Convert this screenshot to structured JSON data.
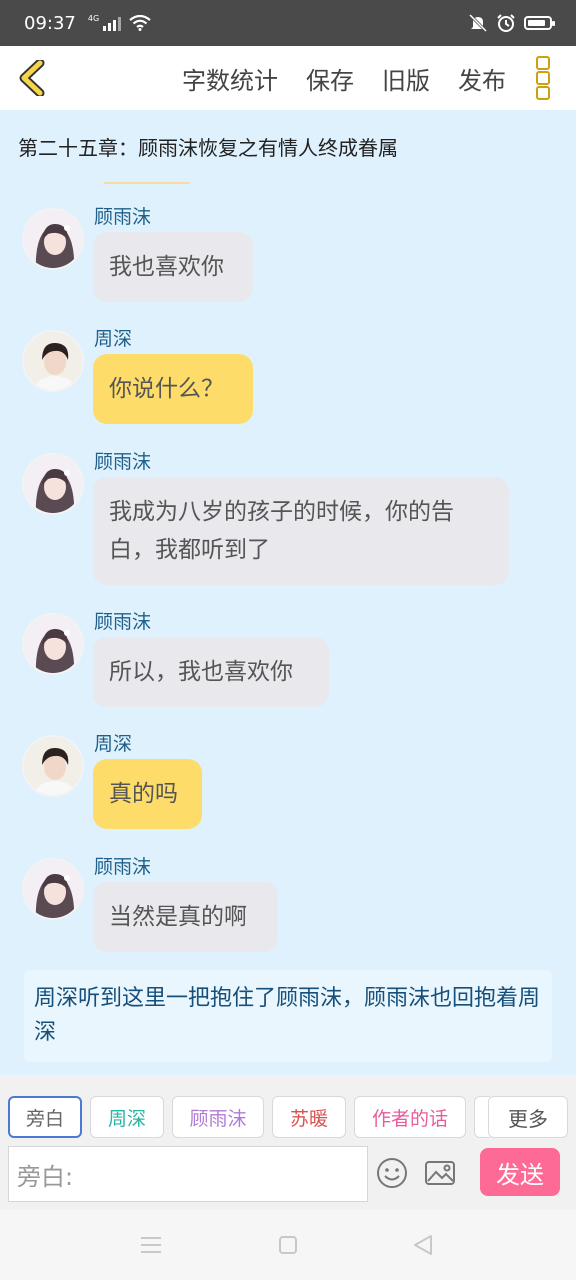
{
  "status_bar": {
    "time": "09:37",
    "network": "4G"
  },
  "toolbar": {
    "items": [
      "字数统计",
      "保存",
      "旧版",
      "发布"
    ]
  },
  "chapter_title": "第二十五章：顾雨沫恢复之有情人终成眷属",
  "messages": [
    {
      "speaker": "顾雨沫",
      "text": "我也喜欢你",
      "side": "female"
    },
    {
      "speaker": "周深",
      "text": "你说什么？",
      "side": "male"
    },
    {
      "speaker": "顾雨沫",
      "text": "我成为八岁的孩子的时候，你的告白，我都听到了",
      "side": "female"
    },
    {
      "speaker": "顾雨沫",
      "text": "所以，我也喜欢你",
      "side": "female"
    },
    {
      "speaker": "周深",
      "text": "真的吗",
      "side": "male"
    },
    {
      "speaker": "顾雨沫",
      "text": "当然是真的啊",
      "side": "female"
    }
  ],
  "narration": "周深听到这里一把抱住了顾雨沫，顾雨沫也回抱着周深",
  "bottom": {
    "roles": [
      {
        "label": "旁白",
        "color": "#666666"
      },
      {
        "label": "周深",
        "color": "#2bb3a6"
      },
      {
        "label": "顾雨沫",
        "color": "#b07bd6"
      },
      {
        "label": "苏暖",
        "color": "#d9534f"
      },
      {
        "label": "作者的话",
        "color": "#e65c9c"
      }
    ],
    "more_label": "更多",
    "input_placeholder": "旁白:",
    "send_label": "发送"
  },
  "colors": {
    "chat_bg": "#dff1fc",
    "female_bubble": "#e8e8ed",
    "male_bubble": "#fddc6a",
    "name_color": "#1f5f8a",
    "send_button": "#fe6a96",
    "accent_yellow": "#caa10f"
  }
}
